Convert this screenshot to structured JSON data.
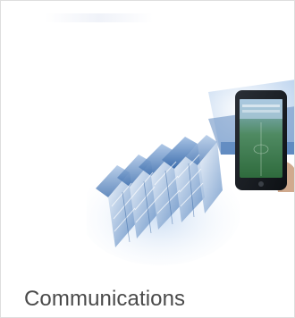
{
  "tile": {
    "caption": "Communications",
    "image_name": "communications-illustration",
    "accent_color": "#1f5fae"
  }
}
